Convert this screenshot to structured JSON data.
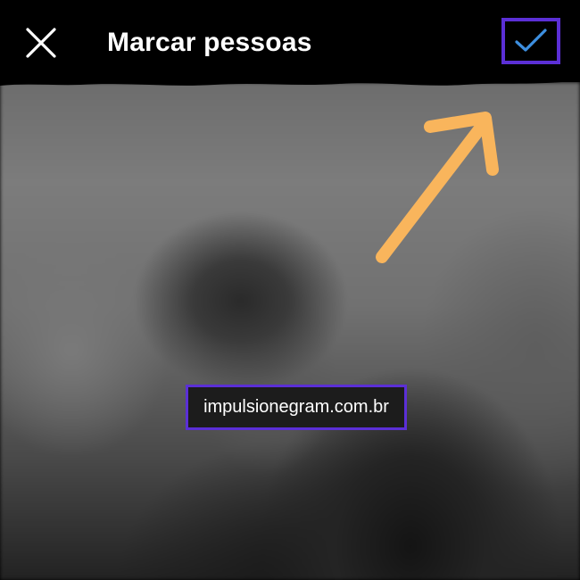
{
  "header": {
    "title": "Marcar pessoas",
    "close_icon": "close-icon",
    "confirm_icon": "checkmark-icon"
  },
  "photo": {
    "tag_label": "impulsionegram.com.br"
  },
  "annotations": {
    "arrow_icon": "arrow-up-right-icon",
    "arrow_color": "#f9b55c",
    "highlight_color": "#5b2fd6"
  },
  "colors": {
    "checkmark": "#3d8fe0",
    "background": "#000000"
  }
}
